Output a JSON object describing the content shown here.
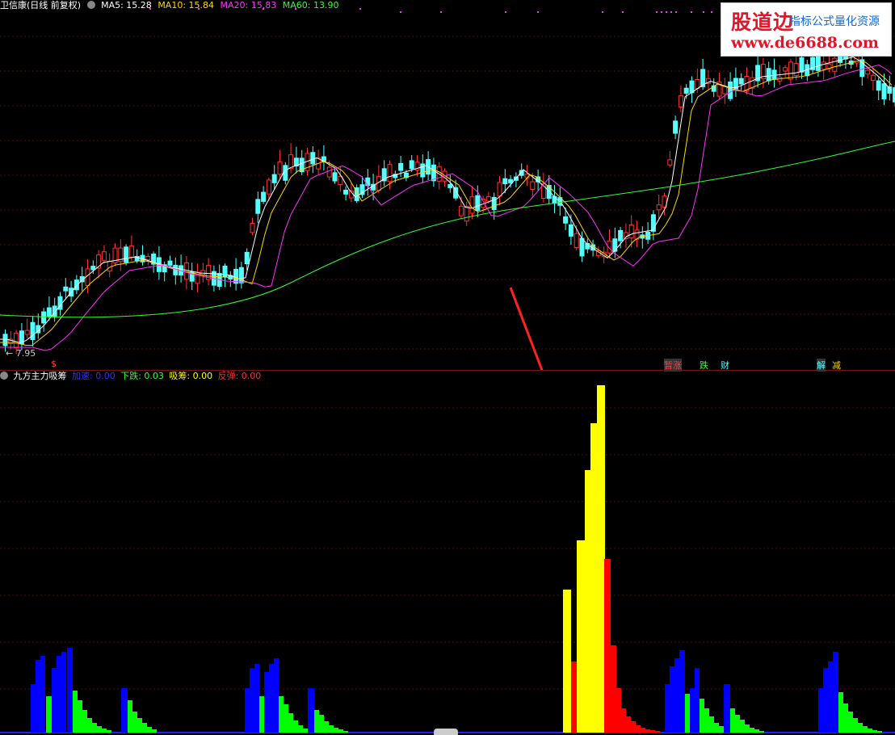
{
  "header": {
    "stock_title": "卫信康(日线 前复权)",
    "ma5": "MA5: 15.28",
    "ma10": "MA10: 15.84",
    "ma20": "MA20: 15.83",
    "ma60": "MA60: 13.90"
  },
  "price_low_label": "← 7.95",
  "signals": {
    "s": "$",
    "a": "暂涨",
    "b": "跌",
    "c": "财",
    "d": "解",
    "e": "减"
  },
  "indicator": {
    "name": "九方主力吸筹",
    "jiasu": "加速: 0.00",
    "xiadie": "下跌: 0.03",
    "xichou": "吸筹: 0.00",
    "fantan": "反弹: 0.00"
  },
  "logo": {
    "main": "股道边",
    "sub": "指标公式量化资源",
    "url": "www.de6688.com"
  },
  "colors": {
    "up": "#ff3232",
    "down": "#54ffff",
    "ma5": "#ffffff",
    "ma10": "#ffd700",
    "ma20": "#ff30ff",
    "ma60": "#30ff30",
    "blue": "#0000ff",
    "green": "#00ff00",
    "yellow": "#ffff00",
    "red": "#ff0000"
  }
}
